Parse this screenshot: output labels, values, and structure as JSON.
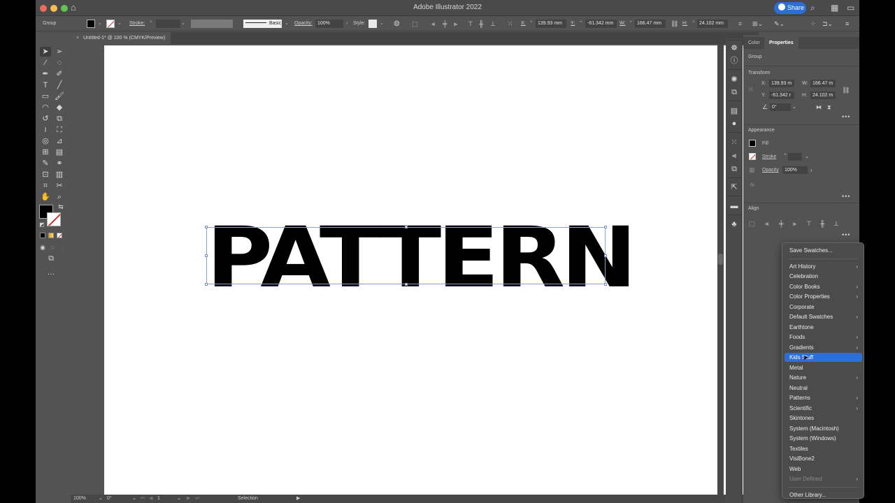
{
  "window": {
    "title": "Adobe Illustrator 2022",
    "share_label": "Share"
  },
  "control_bar": {
    "selection_type": "Group",
    "stroke_label": "Stroke:",
    "stroke_profile": "Basic",
    "opacity_label": "Opacity:",
    "opacity_value": "100%",
    "style_label": "Style:",
    "x_label": "X:",
    "x_value": "139.93 mm",
    "y_label": "Y:",
    "y_value": "-61.342 mm",
    "w_label": "W:",
    "w_value": "166.47 mm",
    "h_label": "H:",
    "h_value": "24.102 mm"
  },
  "document_tab": {
    "title": "Untitled-1* @ 100 % (CMYK/Preview)"
  },
  "artboard": {
    "text": "PATTERN"
  },
  "status_bar": {
    "zoom": "100%",
    "rotation": "0°",
    "artboard_number": "1",
    "current_tool": "Selection"
  },
  "properties_panel": {
    "tabs": [
      {
        "label": "Color",
        "active": false
      },
      {
        "label": "Properties",
        "active": true
      }
    ],
    "selection_type": "Group",
    "transform": {
      "heading": "Transform",
      "x_label": "X:",
      "x_value": "139.93 m",
      "y_label": "Y:",
      "y_value": "-61.342 r",
      "w_label": "W:",
      "w_value": "166.47 m",
      "h_label": "H:",
      "h_value": "24.102 m",
      "angle_value": "0°"
    },
    "appearance": {
      "heading": "Appearance",
      "fill_label": "Fill",
      "stroke_label": "Stroke",
      "opacity_label": "Opacity",
      "opacity_value": "100%",
      "fx_label": "fx."
    },
    "align": {
      "heading": "Align"
    }
  },
  "swatch_library_menu": {
    "items": [
      {
        "label": "Save Swatches...",
        "submenu": false,
        "state": "normal"
      },
      {
        "label": "Art History",
        "submenu": true,
        "state": "normal"
      },
      {
        "label": "Celebration",
        "submenu": false,
        "state": "normal"
      },
      {
        "label": "Color Books",
        "submenu": true,
        "state": "normal"
      },
      {
        "label": "Color Properties",
        "submenu": true,
        "state": "normal"
      },
      {
        "label": "Corporate",
        "submenu": false,
        "state": "normal"
      },
      {
        "label": "Default Swatches",
        "submenu": true,
        "state": "normal"
      },
      {
        "label": "Earthtone",
        "submenu": false,
        "state": "normal"
      },
      {
        "label": "Foods",
        "submenu": true,
        "state": "normal"
      },
      {
        "label": "Gradients",
        "submenu": true,
        "state": "normal"
      },
      {
        "label": "Kids Stuff",
        "submenu": false,
        "state": "selected"
      },
      {
        "label": "Metal",
        "submenu": false,
        "state": "normal"
      },
      {
        "label": "Nature",
        "submenu": true,
        "state": "normal"
      },
      {
        "label": "Neutral",
        "submenu": false,
        "state": "normal"
      },
      {
        "label": "Patterns",
        "submenu": true,
        "state": "normal"
      },
      {
        "label": "Scientific",
        "submenu": true,
        "state": "normal"
      },
      {
        "label": "Skintones",
        "submenu": false,
        "state": "normal"
      },
      {
        "label": "System (Macintosh)",
        "submenu": false,
        "state": "normal"
      },
      {
        "label": "System (Windows)",
        "submenu": false,
        "state": "normal"
      },
      {
        "label": "Textiles",
        "submenu": false,
        "state": "normal"
      },
      {
        "label": "VisiBone2",
        "submenu": false,
        "state": "normal"
      },
      {
        "label": "Web",
        "submenu": false,
        "state": "normal"
      },
      {
        "label": "User Defined",
        "submenu": true,
        "state": "disabled"
      },
      {
        "label": "Other Library...",
        "submenu": false,
        "state": "normal"
      }
    ]
  },
  "swatch_colors": [
    "#f0a030",
    "#f4b040",
    "#f4d040",
    "#c02870",
    "#d8306a",
    "#e03a78"
  ],
  "colors": {
    "accent": "#2e6de0",
    "share": "#2d6fd9",
    "fill": "#000000",
    "stroke_none": "#d03030",
    "ui_bg": "#535353"
  }
}
